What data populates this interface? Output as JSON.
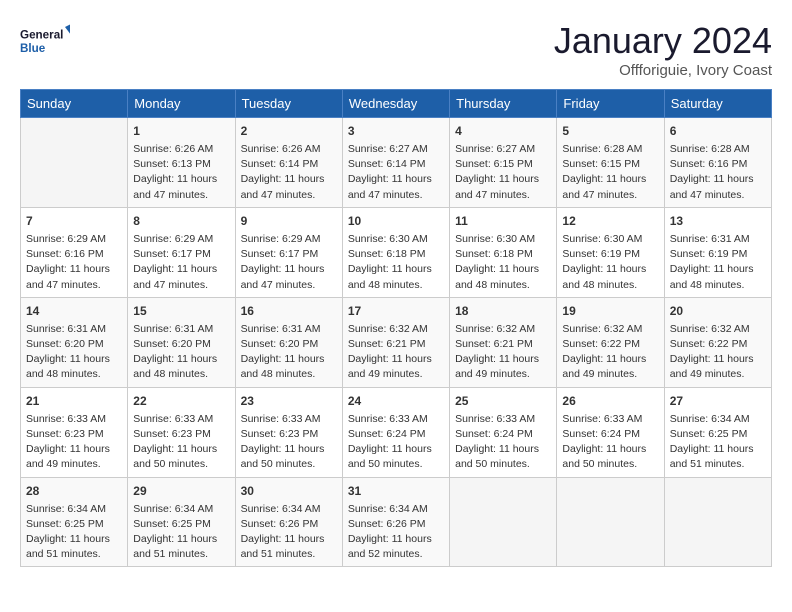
{
  "logo": {
    "line1": "General",
    "line2": "Blue"
  },
  "title": "January 2024",
  "subtitle": "Offforiguie, Ivory Coast",
  "days_of_week": [
    "Sunday",
    "Monday",
    "Tuesday",
    "Wednesday",
    "Thursday",
    "Friday",
    "Saturday"
  ],
  "weeks": [
    [
      {
        "num": "",
        "info": ""
      },
      {
        "num": "1",
        "info": "Sunrise: 6:26 AM\nSunset: 6:13 PM\nDaylight: 11 hours\nand 47 minutes."
      },
      {
        "num": "2",
        "info": "Sunrise: 6:26 AM\nSunset: 6:14 PM\nDaylight: 11 hours\nand 47 minutes."
      },
      {
        "num": "3",
        "info": "Sunrise: 6:27 AM\nSunset: 6:14 PM\nDaylight: 11 hours\nand 47 minutes."
      },
      {
        "num": "4",
        "info": "Sunrise: 6:27 AM\nSunset: 6:15 PM\nDaylight: 11 hours\nand 47 minutes."
      },
      {
        "num": "5",
        "info": "Sunrise: 6:28 AM\nSunset: 6:15 PM\nDaylight: 11 hours\nand 47 minutes."
      },
      {
        "num": "6",
        "info": "Sunrise: 6:28 AM\nSunset: 6:16 PM\nDaylight: 11 hours\nand 47 minutes."
      }
    ],
    [
      {
        "num": "7",
        "info": "Sunrise: 6:29 AM\nSunset: 6:16 PM\nDaylight: 11 hours\nand 47 minutes."
      },
      {
        "num": "8",
        "info": "Sunrise: 6:29 AM\nSunset: 6:17 PM\nDaylight: 11 hours\nand 47 minutes."
      },
      {
        "num": "9",
        "info": "Sunrise: 6:29 AM\nSunset: 6:17 PM\nDaylight: 11 hours\nand 47 minutes."
      },
      {
        "num": "10",
        "info": "Sunrise: 6:30 AM\nSunset: 6:18 PM\nDaylight: 11 hours\nand 48 minutes."
      },
      {
        "num": "11",
        "info": "Sunrise: 6:30 AM\nSunset: 6:18 PM\nDaylight: 11 hours\nand 48 minutes."
      },
      {
        "num": "12",
        "info": "Sunrise: 6:30 AM\nSunset: 6:19 PM\nDaylight: 11 hours\nand 48 minutes."
      },
      {
        "num": "13",
        "info": "Sunrise: 6:31 AM\nSunset: 6:19 PM\nDaylight: 11 hours\nand 48 minutes."
      }
    ],
    [
      {
        "num": "14",
        "info": "Sunrise: 6:31 AM\nSunset: 6:20 PM\nDaylight: 11 hours\nand 48 minutes."
      },
      {
        "num": "15",
        "info": "Sunrise: 6:31 AM\nSunset: 6:20 PM\nDaylight: 11 hours\nand 48 minutes."
      },
      {
        "num": "16",
        "info": "Sunrise: 6:31 AM\nSunset: 6:20 PM\nDaylight: 11 hours\nand 48 minutes."
      },
      {
        "num": "17",
        "info": "Sunrise: 6:32 AM\nSunset: 6:21 PM\nDaylight: 11 hours\nand 49 minutes."
      },
      {
        "num": "18",
        "info": "Sunrise: 6:32 AM\nSunset: 6:21 PM\nDaylight: 11 hours\nand 49 minutes."
      },
      {
        "num": "19",
        "info": "Sunrise: 6:32 AM\nSunset: 6:22 PM\nDaylight: 11 hours\nand 49 minutes."
      },
      {
        "num": "20",
        "info": "Sunrise: 6:32 AM\nSunset: 6:22 PM\nDaylight: 11 hours\nand 49 minutes."
      }
    ],
    [
      {
        "num": "21",
        "info": "Sunrise: 6:33 AM\nSunset: 6:23 PM\nDaylight: 11 hours\nand 49 minutes."
      },
      {
        "num": "22",
        "info": "Sunrise: 6:33 AM\nSunset: 6:23 PM\nDaylight: 11 hours\nand 50 minutes."
      },
      {
        "num": "23",
        "info": "Sunrise: 6:33 AM\nSunset: 6:23 PM\nDaylight: 11 hours\nand 50 minutes."
      },
      {
        "num": "24",
        "info": "Sunrise: 6:33 AM\nSunset: 6:24 PM\nDaylight: 11 hours\nand 50 minutes."
      },
      {
        "num": "25",
        "info": "Sunrise: 6:33 AM\nSunset: 6:24 PM\nDaylight: 11 hours\nand 50 minutes."
      },
      {
        "num": "26",
        "info": "Sunrise: 6:33 AM\nSunset: 6:24 PM\nDaylight: 11 hours\nand 50 minutes."
      },
      {
        "num": "27",
        "info": "Sunrise: 6:34 AM\nSunset: 6:25 PM\nDaylight: 11 hours\nand 51 minutes."
      }
    ],
    [
      {
        "num": "28",
        "info": "Sunrise: 6:34 AM\nSunset: 6:25 PM\nDaylight: 11 hours\nand 51 minutes."
      },
      {
        "num": "29",
        "info": "Sunrise: 6:34 AM\nSunset: 6:25 PM\nDaylight: 11 hours\nand 51 minutes."
      },
      {
        "num": "30",
        "info": "Sunrise: 6:34 AM\nSunset: 6:26 PM\nDaylight: 11 hours\nand 51 minutes."
      },
      {
        "num": "31",
        "info": "Sunrise: 6:34 AM\nSunset: 6:26 PM\nDaylight: 11 hours\nand 52 minutes."
      },
      {
        "num": "",
        "info": ""
      },
      {
        "num": "",
        "info": ""
      },
      {
        "num": "",
        "info": ""
      }
    ]
  ]
}
